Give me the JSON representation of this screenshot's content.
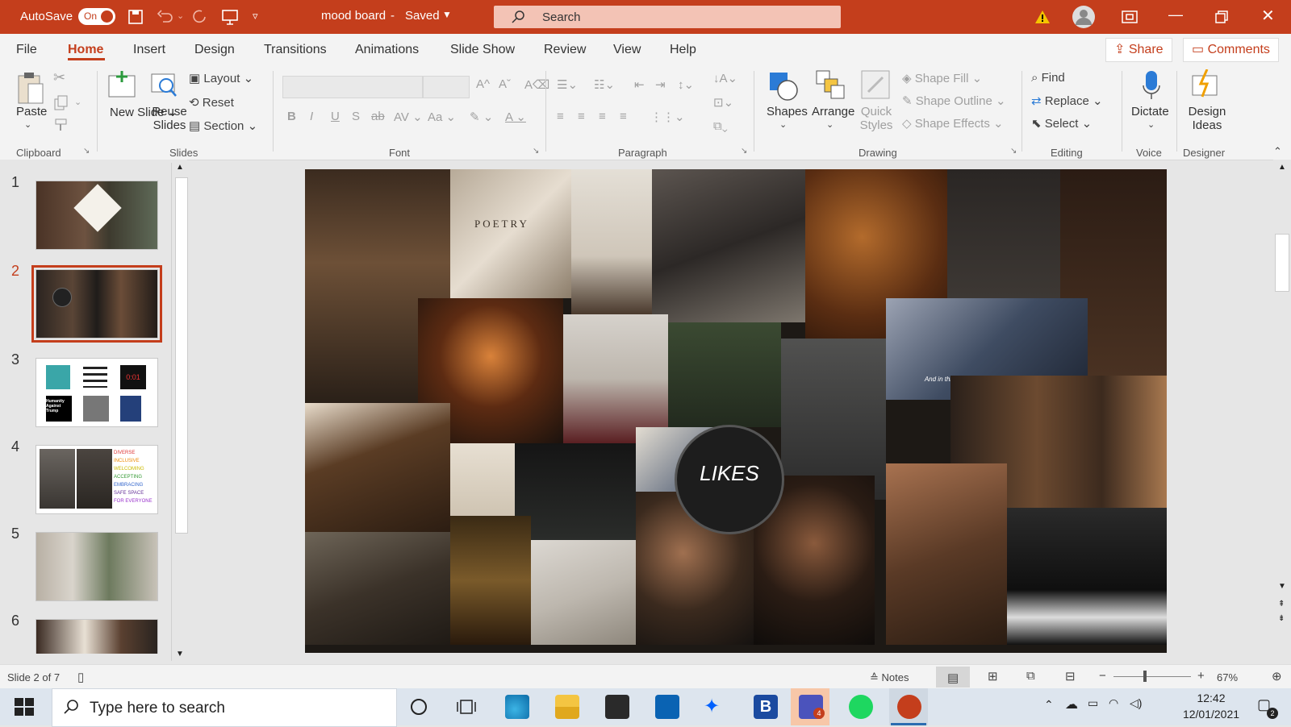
{
  "titlebar": {
    "autosave_label": "AutoSave",
    "autosave_state": "On",
    "doc_title": "mood board",
    "doc_sep": "-",
    "save_status": "Saved",
    "search_placeholder": "Search",
    "accent_color": "#c43e1c"
  },
  "menu": {
    "items": [
      "File",
      "Home",
      "Insert",
      "Design",
      "Transitions",
      "Animations",
      "Slide Show",
      "Review",
      "View",
      "Help"
    ],
    "active": "Home",
    "share_label": "Share",
    "comments_label": "Comments"
  },
  "ribbon": {
    "clipboard": {
      "group": "Clipboard",
      "paste": "Paste"
    },
    "slides": {
      "group": "Slides",
      "new_slide": "New Slide",
      "reuse_slides": "Reuse Slides",
      "layout": "Layout",
      "reset": "Reset",
      "section": "Section"
    },
    "font": {
      "group": "Font",
      "bold": "B",
      "italic": "I",
      "underline": "U",
      "strike": "S",
      "case": "Aa"
    },
    "paragraph": {
      "group": "Paragraph"
    },
    "drawing": {
      "group": "Drawing",
      "shapes": "Shapes",
      "arrange": "Arrange",
      "quick_styles": "Quick Styles",
      "shape_fill": "Shape Fill",
      "shape_outline": "Shape Outline",
      "shape_effects": "Shape Effects"
    },
    "editing": {
      "group": "Editing",
      "find": "Find",
      "replace": "Replace",
      "select": "Select"
    },
    "voice": {
      "group": "Voice",
      "dictate": "Dictate"
    },
    "designer": {
      "group": "Designer",
      "design_ideas": "Design Ideas"
    }
  },
  "thumbnails": {
    "numbers": [
      "1",
      "2",
      "3",
      "4",
      "5",
      "6"
    ],
    "selected": "2",
    "slide3_texts": [
      "0:01",
      "Humanity Against Trump"
    ],
    "slide4_words": [
      "DIVERSE",
      "INCLUSIVE",
      "WELCOMING",
      "ACCEPTING",
      "EMBRACING",
      "SAFE SPACE",
      "FOR EVERYONE"
    ]
  },
  "slide": {
    "label": "LIKES",
    "caption": "And in this moment, I swear, we are infinite.",
    "book_word": "POETRY"
  },
  "status": {
    "slide_info": "Slide 2 of 7",
    "notes_label": "Notes",
    "zoom_label": "67%",
    "zoom_minus": "−",
    "zoom_plus": "+"
  },
  "taskbar": {
    "search_placeholder": "Type here to search",
    "time": "12:42",
    "date": "12/01/2021",
    "teams_badge": "4",
    "notification_count": "2",
    "bluebook_letter": "B"
  }
}
